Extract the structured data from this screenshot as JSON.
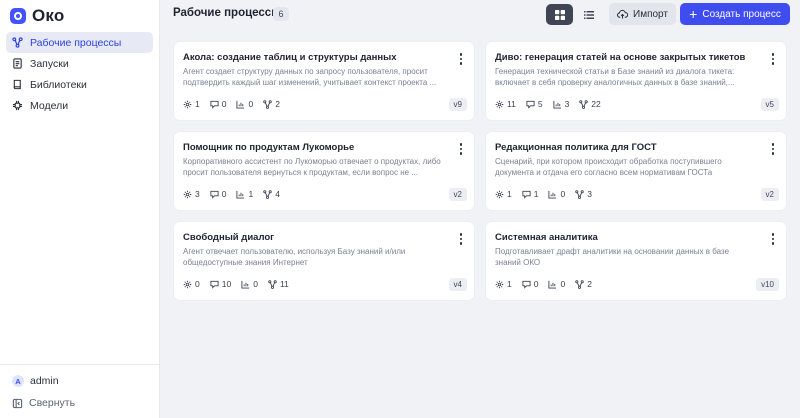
{
  "app": {
    "name": "Око"
  },
  "sidebar": {
    "items": [
      {
        "label": "Рабочие процессы",
        "icon": "workflow-icon",
        "active": true
      },
      {
        "label": "Запуски",
        "icon": "document-icon",
        "active": false
      },
      {
        "label": "Библиотеки",
        "icon": "book-icon",
        "active": false
      },
      {
        "label": "Модели",
        "icon": "model-icon",
        "active": false
      }
    ],
    "user": {
      "initial": "A",
      "name": "admin"
    },
    "collapse_label": "Свернуть"
  },
  "header": {
    "title": "Рабочие процессы",
    "count": "6",
    "import_label": "Импорт",
    "create_label": "Создать процесс"
  },
  "colors": {
    "accent": "#3f4cf0",
    "active_nav_bg": "#e7eaf4",
    "background": "#f1f2f6"
  },
  "cards": [
    {
      "title": "Акола: создание таблиц и структуры данных",
      "description": "Агент создает структуру данных по запросу пользователя, просит подтвердить каждый шаг изменений, учитывает контекст проекта ...",
      "stats": [
        "1",
        "0",
        "0",
        "2"
      ],
      "version": "v9"
    },
    {
      "title": "Диво: генерация статей на основе закрытых тикетов",
      "description": "Генерация технической статьи в Базе знаний из диалога тикета: включает в себя проверку аналогичных данных в базе знаний,...",
      "stats": [
        "11",
        "5",
        "3",
        "22"
      ],
      "version": "v5"
    },
    {
      "title": "Помощник по продуктам Лукоморье",
      "description": "Корпоративного ассистент по Лукоморью отвечает о продуктах, либо просит пользователя вернуться к продуктам, если вопрос не ...",
      "stats": [
        "3",
        "0",
        "1",
        "4"
      ],
      "version": "v2"
    },
    {
      "title": "Редакционная политика для ГОСТ",
      "description": "Сценарий, при котором происходит обработка поступившего документа и отдача его согласно всем нормативам ГОСТа",
      "stats": [
        "1",
        "1",
        "0",
        "3"
      ],
      "version": "v2"
    },
    {
      "title": "Свободный диалог",
      "description": "Агент отвечает пользователю, используя Базу знаний и/или общедоступные знания Интернет",
      "stats": [
        "0",
        "10",
        "0",
        "11"
      ],
      "version": "v4"
    },
    {
      "title": "Системная аналитика",
      "description": "Подготавливает драфт аналитики на основании данных в базе знаний ОКО",
      "stats": [
        "1",
        "0",
        "0",
        "2"
      ],
      "version": "v10"
    }
  ],
  "stat_icons": [
    "gear-icon",
    "chat-icon",
    "chart-icon",
    "branch-icon"
  ]
}
